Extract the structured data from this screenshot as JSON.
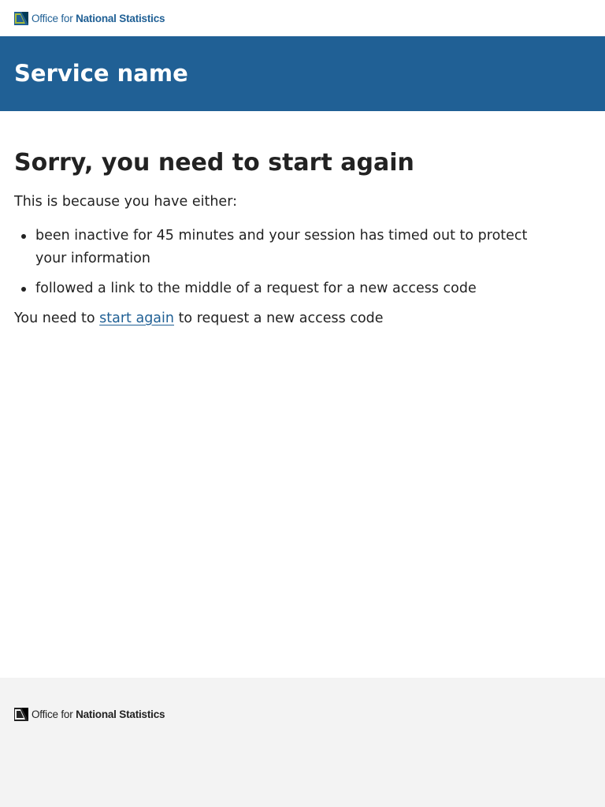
{
  "header": {
    "logo": {
      "icon": "ons-logo-icon",
      "text_regular": "Office for ",
      "text_bold": "National Statistics"
    }
  },
  "service": {
    "name": "Service name"
  },
  "main": {
    "title": "Sorry, you need to start again",
    "intro": "This is because you have either:",
    "reasons": [
      "been inactive for 45 minutes and your session has timed out to protect your information",
      "followed a link to the middle of a request for a new access code"
    ],
    "action": {
      "prefix": "You need to ",
      "link_label": "start again",
      "suffix": " to request a new access code"
    }
  },
  "footer": {
    "logo": {
      "icon": "ons-logo-icon",
      "text_regular": "Office for ",
      "text_bold": "National Statistics"
    }
  },
  "colors": {
    "brand_blue": "#206095",
    "logo_green": "#a8bd3a",
    "logo_dark": "#003c57",
    "footer_bg": "#f3f3f3",
    "text": "#222222"
  }
}
